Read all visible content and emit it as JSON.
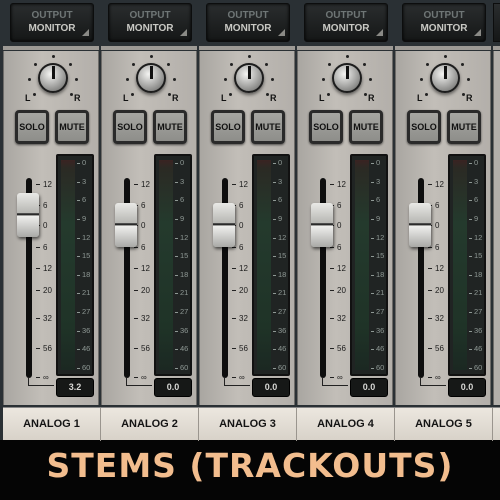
{
  "channels": [
    {
      "output_top": "OUTPUT",
      "output_bottom": "MONITOR",
      "pan_left": "L",
      "pan_right": "R",
      "solo": "SOLO",
      "mute": "MUTE",
      "readout": "3.2",
      "fader_db": 3,
      "name": "ANALOG 1"
    },
    {
      "output_top": "OUTPUT",
      "output_bottom": "MONITOR",
      "pan_left": "L",
      "pan_right": "R",
      "solo": "SOLO",
      "mute": "MUTE",
      "readout": "0.0",
      "fader_db": 0,
      "name": "ANALOG 2"
    },
    {
      "output_top": "OUTPUT",
      "output_bottom": "MONITOR",
      "pan_left": "L",
      "pan_right": "R",
      "solo": "SOLO",
      "mute": "MUTE",
      "readout": "0.0",
      "fader_db": 0,
      "name": "ANALOG 3"
    },
    {
      "output_top": "OUTPUT",
      "output_bottom": "MONITOR",
      "pan_left": "L",
      "pan_right": "R",
      "solo": "SOLO",
      "mute": "MUTE",
      "readout": "0.0",
      "fader_db": 0,
      "name": "ANALOG 4"
    },
    {
      "output_top": "OUTPUT",
      "output_bottom": "MONITOR",
      "pan_left": "L",
      "pan_right": "R",
      "solo": "SOLO",
      "mute": "MUTE",
      "readout": "0.0",
      "fader_db": 0,
      "name": "ANALOG 5"
    }
  ],
  "fader_scale": [
    "12",
    "6",
    "0",
    "6",
    "12",
    "20",
    "32",
    "56",
    "∞"
  ],
  "meter_scale": [
    "0",
    "3",
    "6",
    "9",
    "12",
    "15",
    "18",
    "21",
    "27",
    "36",
    "46",
    "60"
  ],
  "title": "STEMS (TRACKOUTS)",
  "colors": {
    "title": "#f2bd8e",
    "panel": "#b8b4ae",
    "label_bar": "#e4dfd7"
  }
}
